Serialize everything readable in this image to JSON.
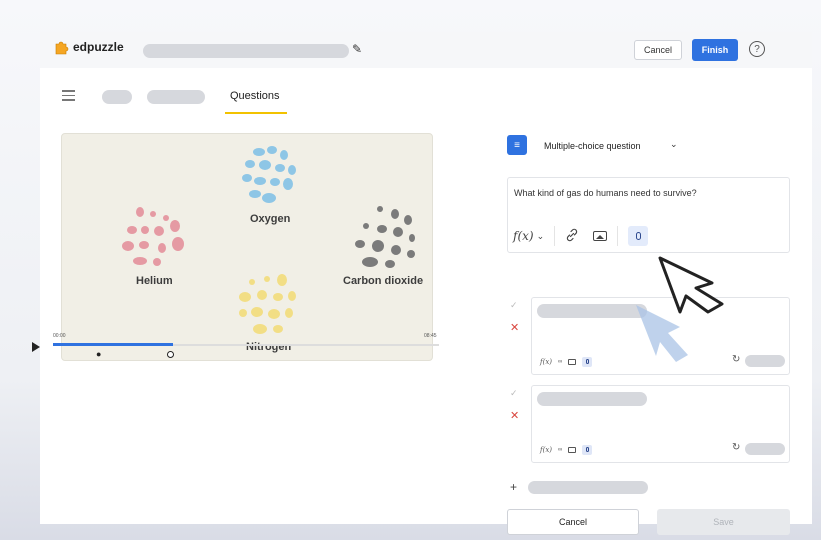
{
  "app": {
    "brand": "edpuzzle"
  },
  "toolbar": {
    "cancel_label": "Cancel",
    "finish_label": "Finish",
    "help_symbol": "?"
  },
  "tabs": {
    "active_label": "Questions"
  },
  "video": {
    "labels": {
      "oxygen": "Oxygen",
      "helium": "Helium",
      "carbon_dioxide": "Carbon dioxide",
      "nitrogen": "Nitrogen"
    },
    "time_start": "00:00",
    "time_end": "08:45",
    "progress_fraction": 0.31
  },
  "question": {
    "type_label": "Multiple-choice question",
    "text": "What kind of gas do humans need to survive?"
  },
  "answers": [
    {
      "correct": false
    },
    {
      "correct": false
    }
  ],
  "footer": {
    "cancel_label": "Cancel",
    "save_label": "Save"
  },
  "icons": {
    "type_icon": "list-icon",
    "formula": "f(x)",
    "check": "✓",
    "cross": "✕",
    "plus": "+",
    "pencil": "✎",
    "link": "🔗",
    "refresh": "↻"
  },
  "colors": {
    "accent": "#2f72e0",
    "tab_underline": "#f2c200",
    "error": "#d9463e",
    "logo": "#f5a623"
  }
}
